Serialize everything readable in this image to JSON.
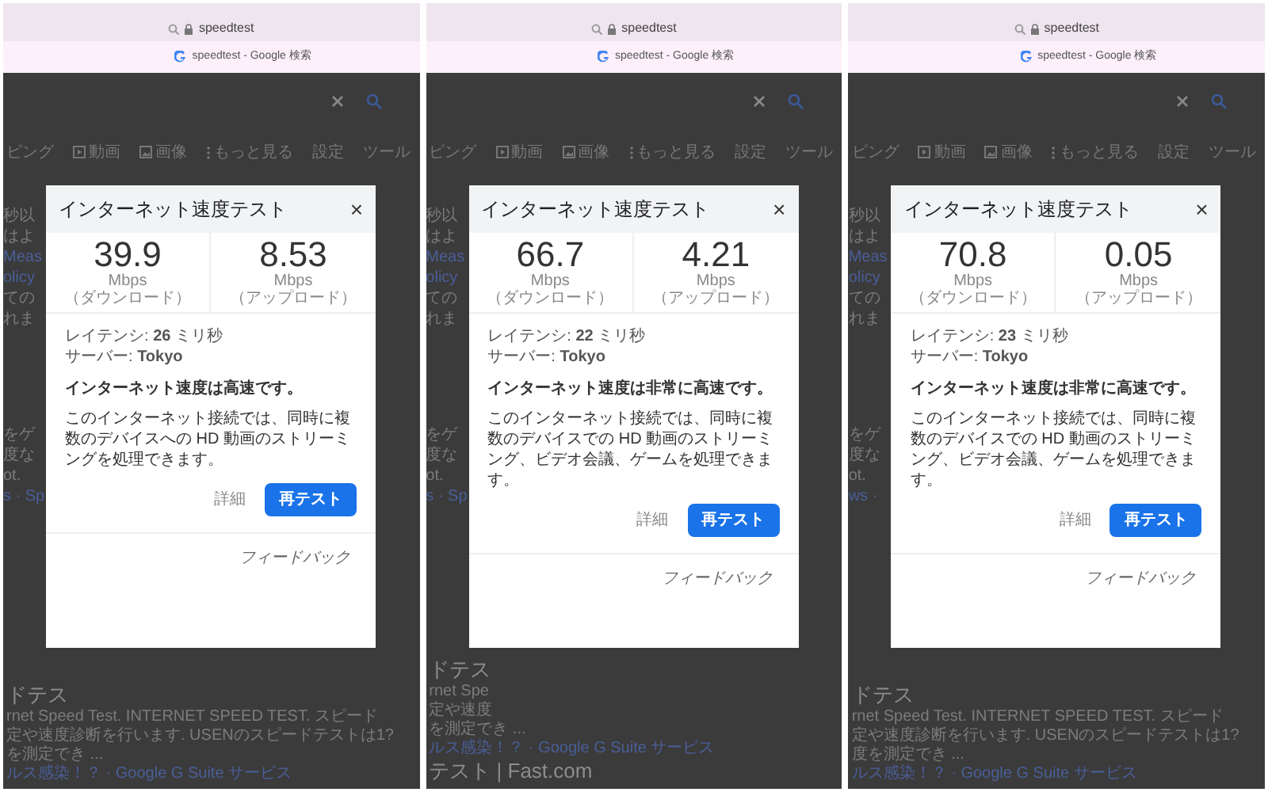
{
  "panels": [
    {
      "address_bar": {
        "text": "speedtest"
      },
      "tab": {
        "title": "speedtest - Google 検索"
      },
      "search_tabs": [
        {
          "kind": "text",
          "label": "ピング"
        },
        {
          "kind": "video",
          "label": "動画"
        },
        {
          "kind": "image",
          "label": "画像"
        },
        {
          "kind": "more",
          "label": "もっと見る"
        },
        {
          "kind": "text",
          "label": "設定"
        },
        {
          "kind": "text",
          "label": "ツール"
        }
      ],
      "side_snippets_top": [
        {
          "kind": "text",
          "text": "秒以"
        },
        {
          "kind": "text",
          "text": "はよ"
        },
        {
          "kind": "link",
          "text": "Meas"
        },
        {
          "kind": "link",
          "text": "olicy"
        },
        {
          "kind": "text",
          "text": "ての"
        },
        {
          "kind": "text",
          "text": "れま"
        }
      ],
      "side_snippets_bottom": [
        {
          "kind": "text",
          "text": "をゲ"
        },
        {
          "kind": "text",
          "text": "度な"
        },
        {
          "kind": "text",
          "text": "ot."
        },
        {
          "kind": "link",
          "text": "s · Sp"
        }
      ],
      "results": [
        {
          "kind": "heading",
          "text": "ドテス"
        },
        {
          "kind": "text",
          "text": "rnet Speed Test. INTERNET SPEED TEST. スピード"
        },
        {
          "kind": "text",
          "text": "定や速度診断を行います. USENのスピードテストは1?"
        },
        {
          "kind": "text",
          "text": "を測定でき ..."
        },
        {
          "kind": "link",
          "text": "ルス感染！？ · Google G Suite サービス"
        }
      ],
      "dialog": {
        "title": "インターネット速度テスト",
        "close": "×",
        "download": {
          "value": "39.9",
          "label": "Mbps（ダウンロード）"
        },
        "upload": {
          "value": "8.53",
          "label": "Mbps（アップロード）"
        },
        "latency": "レイテンシ: **26** ミリ秒",
        "server": "サーバー: **Tokyo**",
        "verdict": "インターネット速度は高速です。",
        "description": "このインターネット接続では、同時に複数のデバイスへの HD 動画のストリーミングを処理できます。",
        "details_button": "詳細",
        "retest_button": "再テスト",
        "feedback": "フィードバック"
      }
    },
    {
      "address_bar": {
        "text": "speedtest"
      },
      "tab": {
        "title": "speedtest - Google 検索"
      },
      "search_tabs": [
        {
          "kind": "text",
          "label": "ピング"
        },
        {
          "kind": "video",
          "label": "動画"
        },
        {
          "kind": "image",
          "label": "画像"
        },
        {
          "kind": "more",
          "label": "もっと見る"
        },
        {
          "kind": "text",
          "label": "設定"
        },
        {
          "kind": "text",
          "label": "ツール"
        }
      ],
      "side_snippets_top": [
        {
          "kind": "text",
          "text": "秒以"
        },
        {
          "kind": "text",
          "text": "はよ"
        },
        {
          "kind": "link",
          "text": "Meas"
        },
        {
          "kind": "link",
          "text": "olicy"
        },
        {
          "kind": "text",
          "text": "ての"
        },
        {
          "kind": "text",
          "text": "れま"
        }
      ],
      "side_snippets_bottom": [
        {
          "kind": "text",
          "text": "をゲ"
        },
        {
          "kind": "text",
          "text": "度な"
        },
        {
          "kind": "text",
          "text": "ot."
        },
        {
          "kind": "link",
          "text": "s · Sp"
        }
      ],
      "results": [
        {
          "kind": "heading",
          "text": "ドテス"
        },
        {
          "kind": "text",
          "text": "rnet Spe"
        },
        {
          "kind": "text",
          "text": "定や速度"
        },
        {
          "kind": "text",
          "text": "を測定でき ..."
        },
        {
          "kind": "link",
          "text": "ルス感染！？ · Google G Suite サービス"
        },
        {
          "kind": "heading",
          "text": "テスト | Fast.com"
        }
      ],
      "dialog": {
        "title": "インターネット速度テスト",
        "close": "×",
        "download": {
          "value": "66.7",
          "label": "Mbps（ダウンロード）"
        },
        "upload": {
          "value": "4.21",
          "label": "Mbps（アップロード）"
        },
        "latency": "レイテンシ: **22** ミリ秒",
        "server": "サーバー: **Tokyo**",
        "verdict": "インターネット速度は非常に高速です。",
        "description": "このインターネット接続では、同時に複数のデバイスでの HD 動画のストリーミング、ビデオ会議、ゲームを処理できます。",
        "details_button": "詳細",
        "retest_button": "再テスト",
        "feedback": "フィードバック"
      }
    },
    {
      "address_bar": {
        "text": "speedtest"
      },
      "tab": {
        "title": "speedtest - Google 検索"
      },
      "search_tabs": [
        {
          "kind": "text",
          "label": "ピング"
        },
        {
          "kind": "video",
          "label": "動画"
        },
        {
          "kind": "image",
          "label": "画像"
        },
        {
          "kind": "more",
          "label": "もっと見る"
        },
        {
          "kind": "text",
          "label": "設定"
        },
        {
          "kind": "text",
          "label": "ツール"
        }
      ],
      "side_snippets_top": [
        {
          "kind": "text",
          "text": "秒以"
        },
        {
          "kind": "text",
          "text": "はよ"
        },
        {
          "kind": "link",
          "text": "Meas"
        },
        {
          "kind": "link",
          "text": "olicy"
        },
        {
          "kind": "text",
          "text": "ての"
        },
        {
          "kind": "text",
          "text": "れま"
        }
      ],
      "side_snippets_bottom": [
        {
          "kind": "text",
          "text": "をゲ"
        },
        {
          "kind": "text",
          "text": "度な"
        },
        {
          "kind": "text",
          "text": "ot."
        },
        {
          "kind": "link",
          "text": "ws ·"
        }
      ],
      "results": [
        {
          "kind": "heading",
          "text": "ドテス"
        },
        {
          "kind": "text",
          "text": "rnet Speed Test. INTERNET SPEED TEST. スピード"
        },
        {
          "kind": "text",
          "text": "定や速度診断を行います. USENのスピードテストは1?"
        },
        {
          "kind": "text",
          "text": "度を測定でき ..."
        },
        {
          "kind": "link",
          "text": "ルス感染！？ · Google G Suite サービス"
        }
      ],
      "dialog": {
        "title": "インターネット速度テスト",
        "close": "×",
        "download": {
          "value": "70.8",
          "label": "Mbps（ダウンロード）"
        },
        "upload": {
          "value": "0.05",
          "label": "Mbps（アップロード）"
        },
        "latency": "レイテンシ: **23** ミリ秒",
        "server": "サーバー: **Tokyo**",
        "verdict": "インターネット速度は非常に高速です。",
        "description": "このインターネット接続では、同時に複数のデバイスでの HD 動画のストリーミング、ビデオ会議、ゲームを処理できます。",
        "details_button": "詳細",
        "retest_button": "再テスト",
        "feedback": "フィードバック"
      }
    }
  ]
}
